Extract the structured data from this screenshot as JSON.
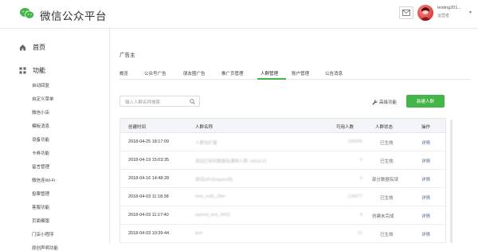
{
  "header": {
    "brand": "微信公众平台",
    "username": "testing201...",
    "role": "运营者",
    "caret": "▼"
  },
  "sidebar": {
    "home_label": "首页",
    "func_label": "功能",
    "items": [
      "自动回复",
      "自定义菜单",
      "微信小店",
      "模板消息",
      "设备功能",
      "卡券功能",
      "留言管理",
      "微信连Wi-Fi",
      "投票管理",
      "客服功能",
      "页面模版",
      "门店小程序",
      "原创声明功能"
    ]
  },
  "main": {
    "breadcrumb": "广告主",
    "tabs": [
      {
        "label": "概览"
      },
      {
        "label": "公众号广告"
      },
      {
        "label": "朋友圈广告"
      },
      {
        "label": "推广页管理"
      },
      {
        "label": "人群管理",
        "active": true
      },
      {
        "label": "账户管理"
      },
      {
        "label": "公告消息"
      }
    ],
    "search_placeholder": "输入人群名称搜索",
    "advanced_label": "高级功能",
    "new_button": "新建人群",
    "table": {
      "headers": {
        "created": "创建时间",
        "name": "人群名称",
        "users": "可用人数",
        "status": "人群状态",
        "action": "操作"
      },
      "rows": [
        {
          "created": "2018-04-25 18:17:09",
          "name": "人群包扩展",
          "users": "328000",
          "status": "已生效",
          "action": "详情"
        },
        {
          "created": "2018-04-19 15:03:35",
          "name": "测试已有的数据包通用人群--0419-01",
          "users": "0",
          "status": "已生效",
          "action": "详情"
        },
        {
          "created": "2018-04-16 14:48:28",
          "name": "测试isPi1Expand包",
          "users": "0",
          "status": "部分数据有误",
          "action": "详情"
        },
        {
          "created": "2018-04-03 11:18:38",
          "name": "imei_md5_28m",
          "users": "128077",
          "status": "已生效",
          "action": "详情"
        },
        {
          "created": "2018-04-03 11:17:40",
          "name": "openid_test_0403",
          "users": "0",
          "status": "创建未完成",
          "action": "详情"
        },
        {
          "created": "2018-04-03 10:39:44",
          "name": "test",
          "users": "21",
          "status": "已生效",
          "action": "详情"
        }
      ]
    }
  }
}
